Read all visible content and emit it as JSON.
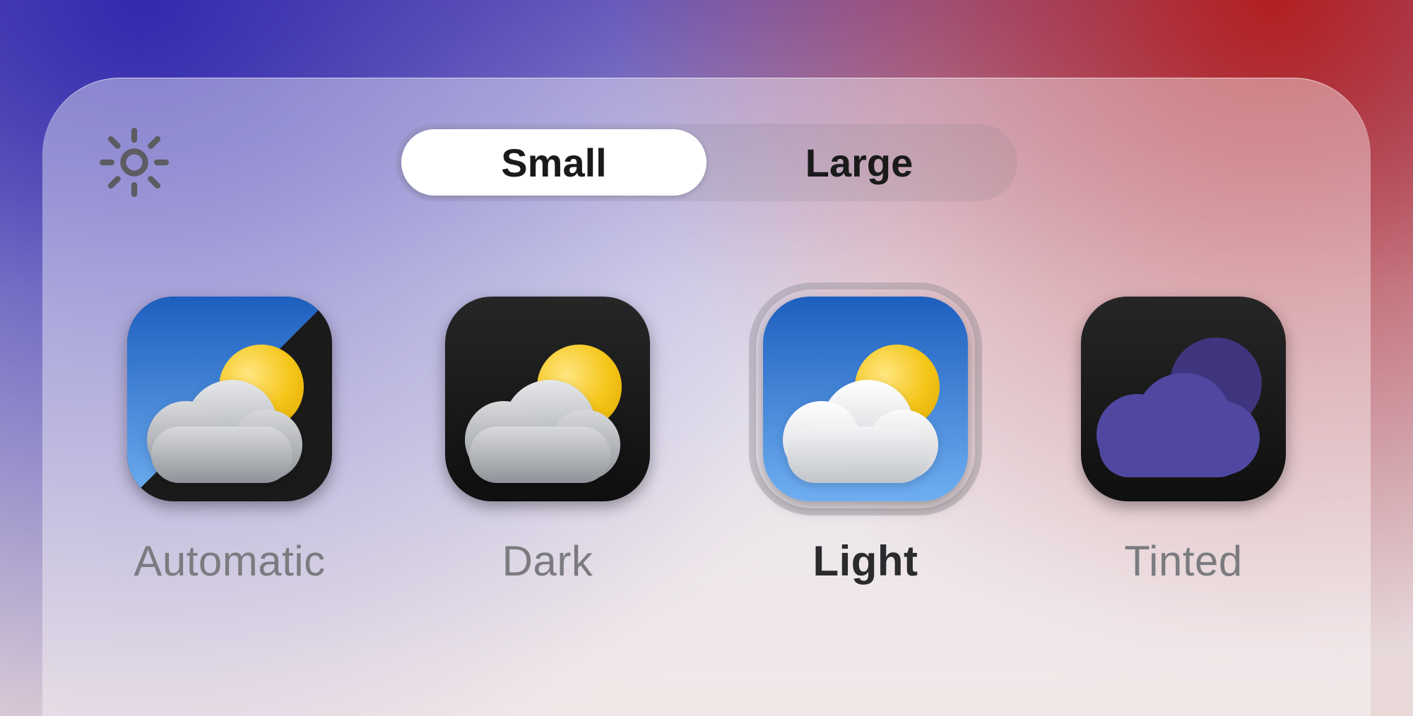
{
  "segmented": {
    "options": [
      "Small",
      "Large"
    ],
    "selected_index": 0
  },
  "appearance_options": [
    {
      "id": "automatic",
      "label": "Automatic",
      "selected": false
    },
    {
      "id": "dark",
      "label": "Dark",
      "selected": false
    },
    {
      "id": "light",
      "label": "Light",
      "selected": true
    },
    {
      "id": "tinted",
      "label": "Tinted",
      "selected": false
    }
  ],
  "icons": {
    "brightness": "brightness-icon"
  }
}
